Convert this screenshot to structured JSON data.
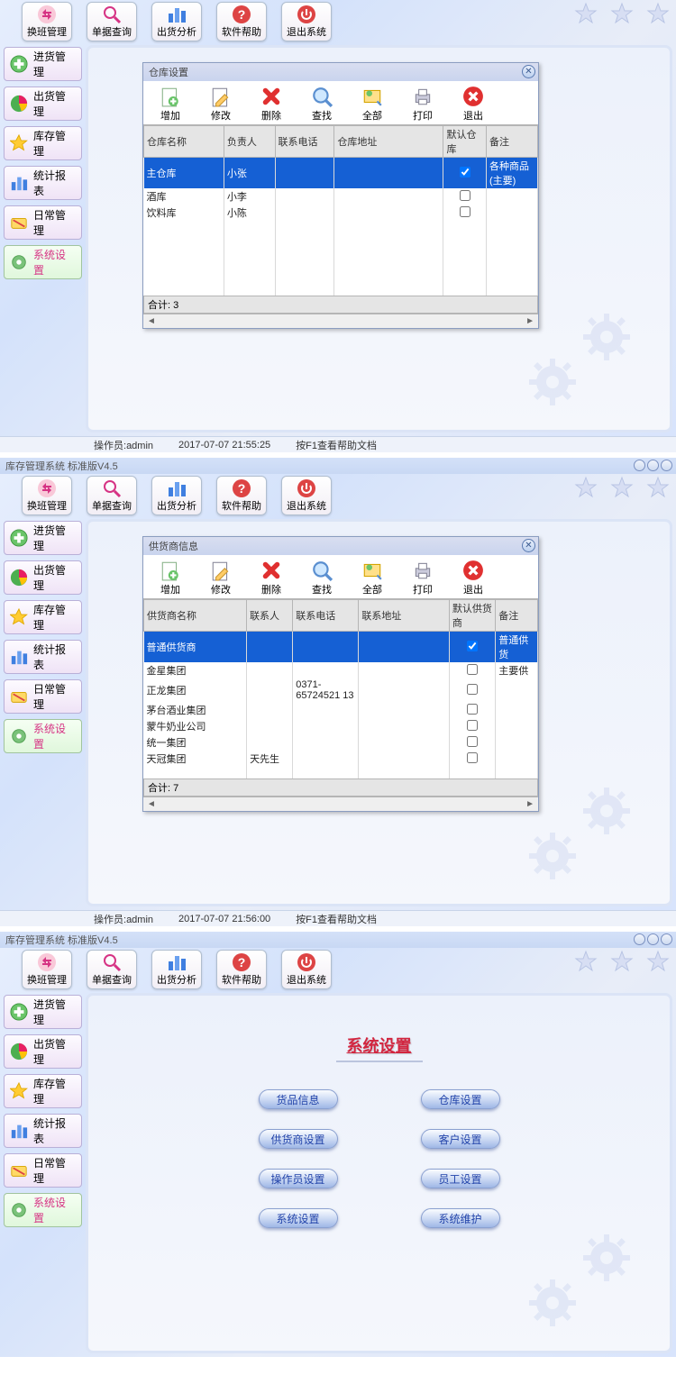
{
  "toolbar_buttons": [
    {
      "id": "shift-mgmt",
      "label": "换班管理",
      "icon": "swap"
    },
    {
      "id": "doc-query",
      "label": "单据查询",
      "icon": "search"
    },
    {
      "id": "ship-analysis",
      "label": "出货分析",
      "icon": "bars"
    },
    {
      "id": "help",
      "label": "软件帮助",
      "icon": "help"
    },
    {
      "id": "exit",
      "label": "退出系统",
      "icon": "power"
    }
  ],
  "sidebar_items": [
    {
      "id": "inbound",
      "label": "进货管理",
      "icon": "plus",
      "color": "#46b646"
    },
    {
      "id": "outbound",
      "label": "出货管理",
      "icon": "pie",
      "color": "#e06"
    },
    {
      "id": "stock",
      "label": "库存管理",
      "icon": "star",
      "color": "#f5c518"
    },
    {
      "id": "report",
      "label": "统计报表",
      "icon": "bars",
      "color": "#3f7fe0"
    },
    {
      "id": "daily",
      "label": "日常管理",
      "icon": "ticket",
      "color": "#f5b518"
    }
  ],
  "system_settings_label": "系统设置",
  "status": {
    "operator_label": "操作员:",
    "operator": "admin",
    "help_hint": "按F1查看帮助文档"
  },
  "panel1": {
    "dialog_title": "仓库设置",
    "toolbar": [
      {
        "id": "add",
        "label": "增加"
      },
      {
        "id": "edit",
        "label": "修改"
      },
      {
        "id": "del",
        "label": "删除"
      },
      {
        "id": "find",
        "label": "查找"
      },
      {
        "id": "all",
        "label": "全部"
      },
      {
        "id": "print",
        "label": "打印"
      },
      {
        "id": "close",
        "label": "退出"
      }
    ],
    "columns": [
      "仓库名称",
      "负责人",
      "联系电话",
      "仓库地址",
      "默认仓库",
      "备注"
    ],
    "rows": [
      {
        "name": "主仓库",
        "person": "小张",
        "phone": "",
        "addr": "",
        "default": true,
        "remark": "各种商品(主要)"
      },
      {
        "name": "酒库",
        "person": "小李",
        "phone": "",
        "addr": "",
        "default": false,
        "remark": ""
      },
      {
        "name": "饮料库",
        "person": "小陈",
        "phone": "",
        "addr": "",
        "default": false,
        "remark": ""
      }
    ],
    "total_label": "合计:",
    "total": "3",
    "timestamp": "2017-07-07 21:55:25"
  },
  "panel2": {
    "app_title": "库存管理系统 标准版V4.5",
    "dialog_title": "供货商信息",
    "toolbar": [
      {
        "id": "add",
        "label": "增加"
      },
      {
        "id": "edit",
        "label": "修改"
      },
      {
        "id": "del",
        "label": "删除"
      },
      {
        "id": "find",
        "label": "查找"
      },
      {
        "id": "all",
        "label": "全部"
      },
      {
        "id": "print",
        "label": "打印"
      },
      {
        "id": "close",
        "label": "退出"
      }
    ],
    "columns": [
      "供货商名称",
      "联系人",
      "联系电话",
      "联系地址",
      "默认供货商",
      "备注"
    ],
    "rows": [
      {
        "name": "普通供货商",
        "person": "",
        "phone": "",
        "addr": "",
        "default": true,
        "remark": "普通供货"
      },
      {
        "name": "金星集团",
        "person": "",
        "phone": "",
        "addr": "",
        "default": false,
        "remark": "主要供"
      },
      {
        "name": "正龙集团",
        "person": "",
        "phone": "0371-65724521 13",
        "addr": "",
        "default": false,
        "remark": ""
      },
      {
        "name": "茅台酒业集团",
        "person": "",
        "phone": "",
        "addr": "",
        "default": false,
        "remark": ""
      },
      {
        "name": "蒙牛奶业公司",
        "person": "",
        "phone": "",
        "addr": "",
        "default": false,
        "remark": ""
      },
      {
        "name": "统一集团",
        "person": "",
        "phone": "",
        "addr": "",
        "default": false,
        "remark": ""
      },
      {
        "name": "天冠集团",
        "person": "天先生",
        "phone": "",
        "addr": "",
        "default": false,
        "remark": ""
      }
    ],
    "total_label": "合计:",
    "total": "7",
    "timestamp": "2017-07-07 21:56:00"
  },
  "panel3": {
    "app_title": "库存管理系统 标准版V4.5",
    "heading": "系统设置",
    "buttons": [
      {
        "id": "goods-info",
        "label": "货品信息"
      },
      {
        "id": "warehouse-set",
        "label": "仓库设置"
      },
      {
        "id": "supplier-set",
        "label": "供货商设置"
      },
      {
        "id": "customer-set",
        "label": "客户设置"
      },
      {
        "id": "operator-set",
        "label": "操作员设置"
      },
      {
        "id": "staff-set",
        "label": "员工设置"
      },
      {
        "id": "system-set",
        "label": "系统设置"
      },
      {
        "id": "system-maint",
        "label": "系统维护"
      }
    ]
  }
}
